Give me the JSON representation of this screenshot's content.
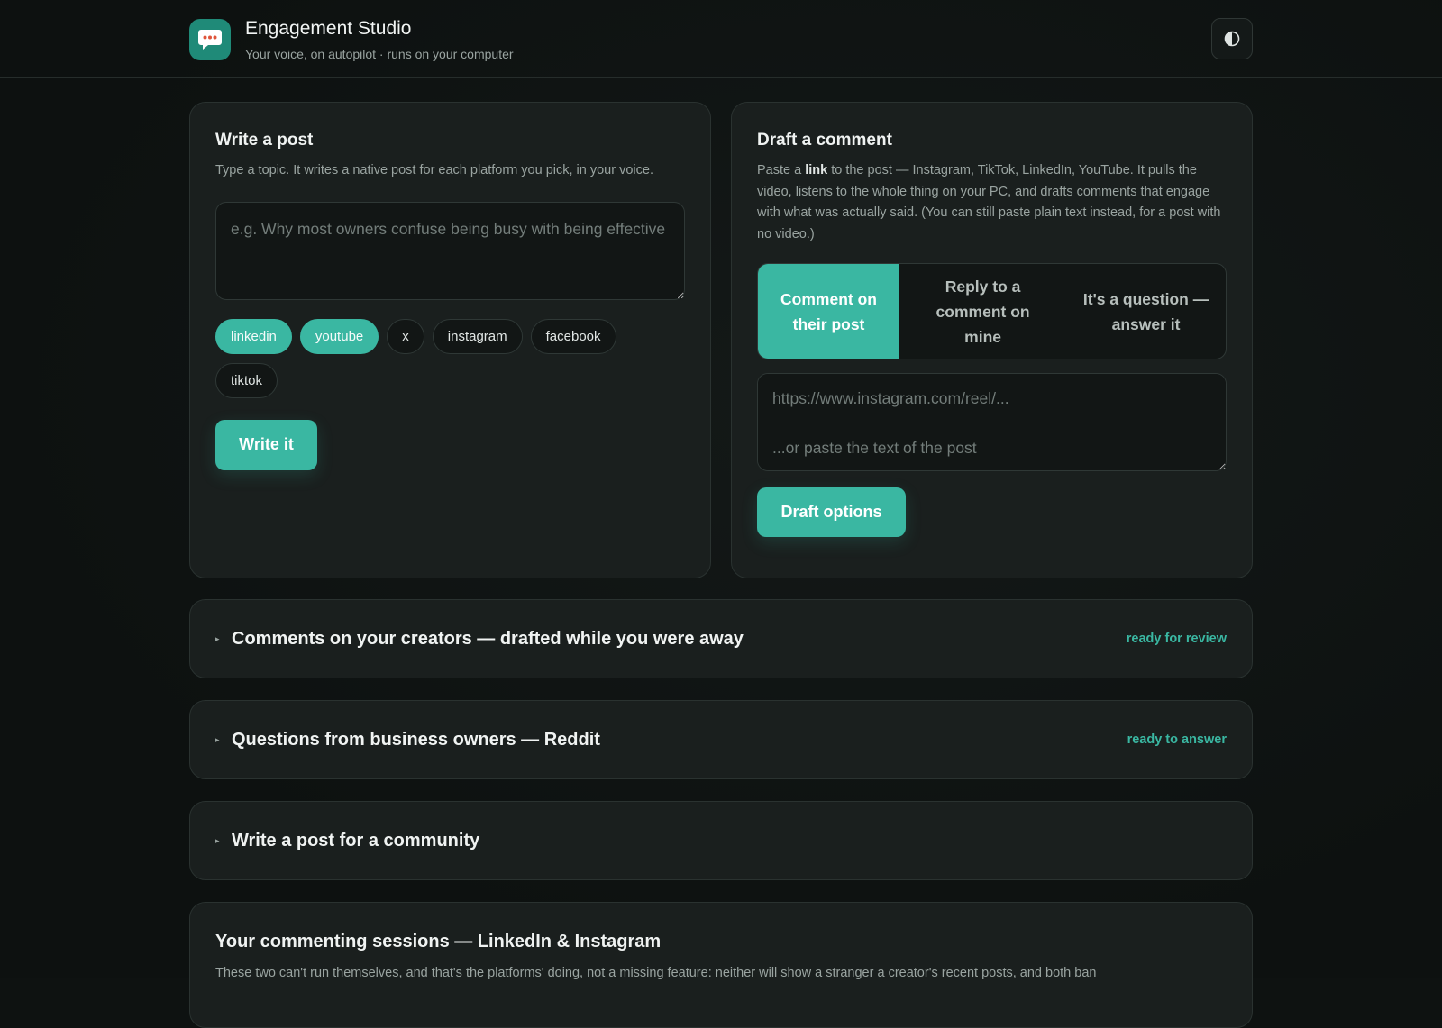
{
  "header": {
    "title": "Engagement Studio",
    "subtitle": "Your voice, on autopilot · runs on your computer"
  },
  "write_post": {
    "title": "Write a post",
    "description": "Type a topic. It writes a native post for each platform you pick, in your voice.",
    "placeholder": "e.g. Why most owners confuse being busy with being effective",
    "platforms": [
      {
        "label": "linkedin",
        "selected": true
      },
      {
        "label": "youtube",
        "selected": true
      },
      {
        "label": "x",
        "selected": false
      },
      {
        "label": "instagram",
        "selected": false
      },
      {
        "label": "facebook",
        "selected": false
      },
      {
        "label": "tiktok",
        "selected": false
      }
    ],
    "button_label": "Write it"
  },
  "draft_comment": {
    "title": "Draft a comment",
    "desc_prefix": "Paste a ",
    "desc_bold": "link",
    "desc_suffix": " to the post — Instagram, TikTok, LinkedIn, YouTube. It pulls the video, listens to the whole thing on your PC, and drafts comments that engage with what was actually said. (You can still paste plain text instead, for a post with no video.)",
    "modes": [
      {
        "label": "Comment on their post",
        "selected": true
      },
      {
        "label": "Reply to a comment on mine",
        "selected": false
      },
      {
        "label": "It's a question — answer it",
        "selected": false
      }
    ],
    "placeholder": "https://www.instagram.com/reel/...\n\n...or paste the text of the post",
    "button_label": "Draft options"
  },
  "sections": [
    {
      "title": "Comments on your creators — drafted while you were away",
      "status": "ready for review"
    },
    {
      "title": "Questions from business owners — Reddit",
      "status": "ready to answer"
    },
    {
      "title": "Write a post for a community",
      "status": ""
    }
  ],
  "sessions": {
    "title": "Your commenting sessions — LinkedIn & Instagram",
    "description": "These two can't run themselves, and that's the platforms' doing, not a missing feature: neither will show a stranger a creator's recent posts, and both ban"
  },
  "colors": {
    "accent": "#3ab7a2",
    "card": "#1a1f1e",
    "background": "#0e1211"
  },
  "icons": {
    "logo": "chat-bubble-icon",
    "theme": "contrast-icon",
    "caret": "caret-right-icon"
  }
}
